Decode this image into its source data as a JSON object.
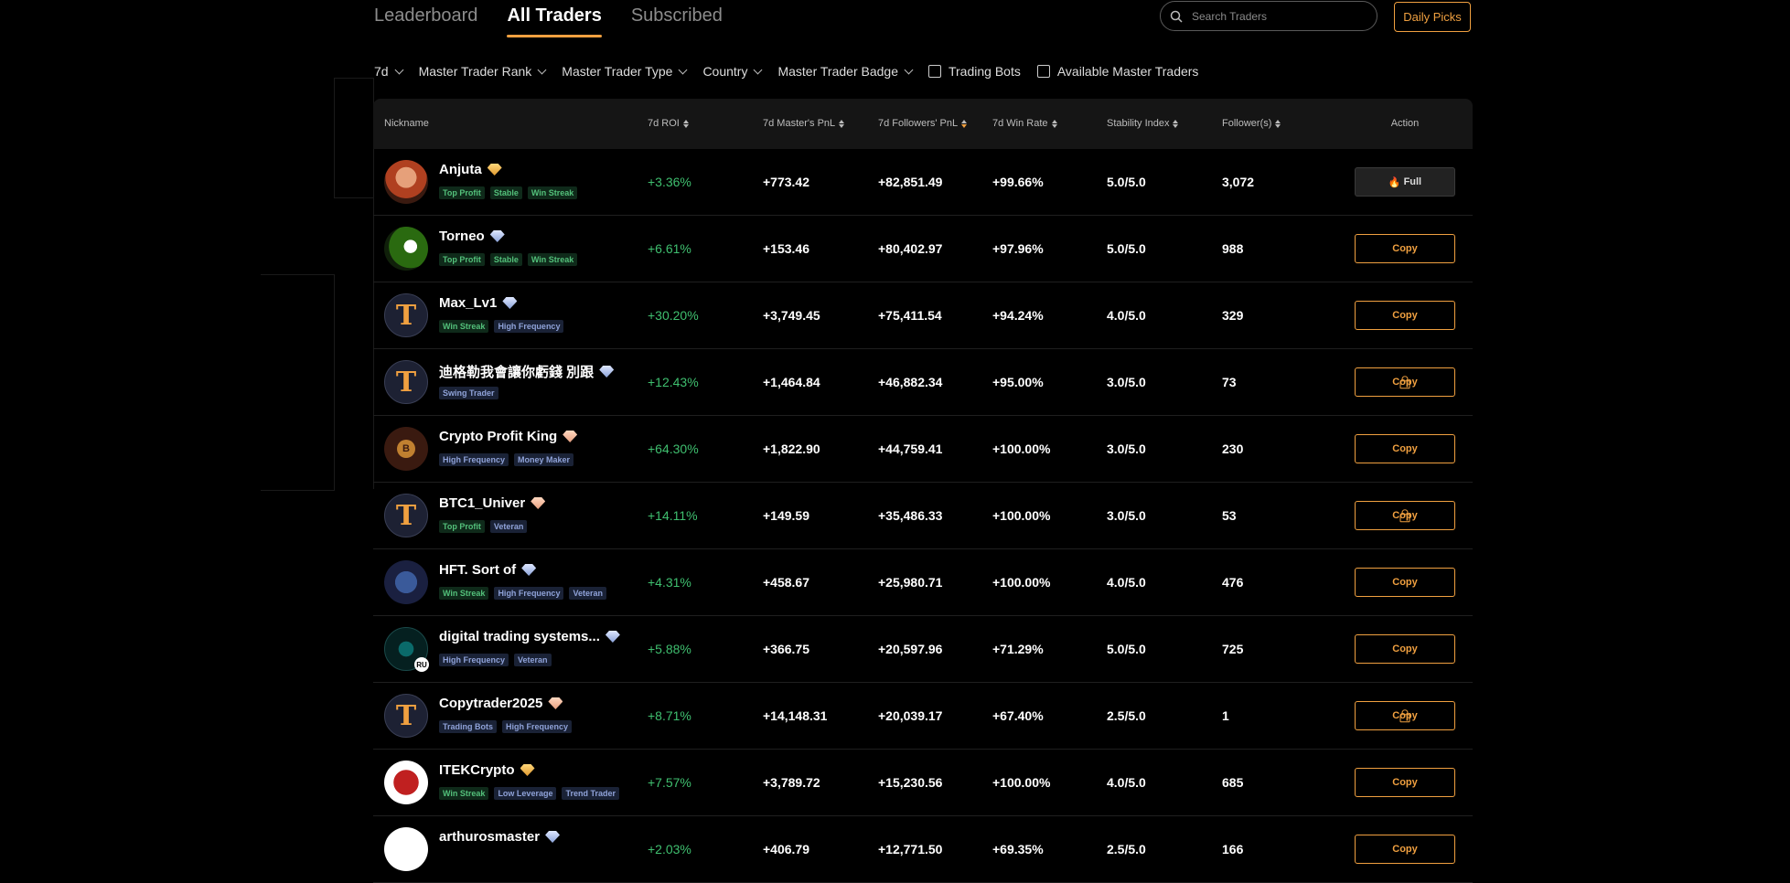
{
  "tabs": [
    {
      "label": "Leaderboard",
      "active": false
    },
    {
      "label": "All Traders",
      "active": true
    },
    {
      "label": "Subscribed",
      "active": false
    }
  ],
  "search": {
    "placeholder": "Search Traders",
    "icon": "search-icon"
  },
  "daily_picks": "Daily Picks",
  "filters": {
    "period": "7d",
    "rank": "Master Trader Rank",
    "type": "Master Trader Type",
    "country": "Country",
    "badge": "Master Trader Badge",
    "trading_bots": "Trading Bots",
    "available": "Available Master Traders"
  },
  "columns": {
    "nickname": "Nickname",
    "roi": "7d ROI",
    "master_pnl": "7d Master's PnL",
    "followers_pnl": "7d Followers' PnL",
    "win_rate": "7d Win Rate",
    "stability": "Stability Index",
    "followers": "Follower(s)",
    "action": "Action"
  },
  "colors": {
    "accent": "#f0a040",
    "positive": "#3fbf6f",
    "background": "#000000"
  },
  "traders": [
    {
      "name": "Anjuta",
      "gem": "gold",
      "avatar": "red-hair-photo",
      "tags": [
        {
          "label": "Top Profit",
          "c": "g"
        },
        {
          "label": "Stable",
          "c": "g"
        },
        {
          "label": "Win Streak",
          "c": "g"
        }
      ],
      "roi": "+3.36%",
      "master_pnl": "+773.42",
      "followers_pnl": "+82,851.49",
      "win_rate": "+99.66%",
      "stability": "5.0/5.0",
      "followers": "3,072",
      "action": "Full",
      "action_icon": "fire-icon",
      "locked": false
    },
    {
      "name": "Torneo",
      "gem": "blue",
      "avatar": "soccer-ball-photo",
      "tags": [
        {
          "label": "Top Profit",
          "c": "g"
        },
        {
          "label": "Stable",
          "c": "g"
        },
        {
          "label": "Win Streak",
          "c": "g"
        }
      ],
      "roi": "+6.61%",
      "master_pnl": "+153.46",
      "followers_pnl": "+80,402.97",
      "win_rate": "+97.96%",
      "stability": "5.0/5.0",
      "followers": "988",
      "action": "Copy",
      "locked": false
    },
    {
      "name": "Max_Lv1",
      "gem": "blue",
      "avatar": "t-logo",
      "tags": [
        {
          "label": "Win Streak",
          "c": "g"
        },
        {
          "label": "High Frequency",
          "c": "b"
        }
      ],
      "roi": "+30.20%",
      "master_pnl": "+3,749.45",
      "followers_pnl": "+75,411.54",
      "win_rate": "+94.24%",
      "stability": "4.0/5.0",
      "followers": "329",
      "action": "Copy",
      "locked": false
    },
    {
      "name": "迪格勒我會讓你虧錢 別跟",
      "gem": "blue",
      "avatar": "t-logo",
      "tags": [
        {
          "label": "Swing Trader",
          "c": "b"
        }
      ],
      "roi": "+12.43%",
      "master_pnl": "+1,464.84",
      "followers_pnl": "+46,882.34",
      "win_rate": "+95.00%",
      "stability": "3.0/5.0",
      "followers": "73",
      "action": "Copy",
      "locked": true
    },
    {
      "name": "Crypto Profit King",
      "gem": "peach",
      "avatar": "memecoin-logo",
      "tags": [
        {
          "label": "High Frequency",
          "c": "b"
        },
        {
          "label": "Money Maker",
          "c": "b"
        }
      ],
      "roi": "+64.30%",
      "master_pnl": "+1,822.90",
      "followers_pnl": "+44,759.41",
      "win_rate": "+100.00%",
      "stability": "3.0/5.0",
      "followers": "230",
      "action": "Copy",
      "locked": false
    },
    {
      "name": "BTC1_Univer",
      "gem": "peach",
      "avatar": "t-logo",
      "tags": [
        {
          "label": "Top Profit",
          "c": "g"
        },
        {
          "label": "Veteran",
          "c": "b"
        }
      ],
      "roi": "+14.11%",
      "master_pnl": "+149.59",
      "followers_pnl": "+35,486.33",
      "win_rate": "+100.00%",
      "stability": "3.0/5.0",
      "followers": "53",
      "action": "Copy",
      "locked": true
    },
    {
      "name": "HFT. Sort of",
      "gem": "blue",
      "avatar": "hft-logo",
      "tags": [
        {
          "label": "Win Streak",
          "c": "g"
        },
        {
          "label": "High Frequency",
          "c": "b"
        },
        {
          "label": "Veteran",
          "c": "b"
        }
      ],
      "roi": "+4.31%",
      "master_pnl": "+458.67",
      "followers_pnl": "+25,980.71",
      "win_rate": "+100.00%",
      "stability": "4.0/5.0",
      "followers": "476",
      "action": "Copy",
      "locked": false
    },
    {
      "name": "digital trading systems...",
      "gem": "blue",
      "avatar": "digital-logo",
      "country": "RU",
      "tags": [
        {
          "label": "High Frequency",
          "c": "b"
        },
        {
          "label": "Veteran",
          "c": "b"
        }
      ],
      "roi": "+5.88%",
      "master_pnl": "+366.75",
      "followers_pnl": "+20,597.96",
      "win_rate": "+71.29%",
      "stability": "5.0/5.0",
      "followers": "725",
      "action": "Copy",
      "locked": false
    },
    {
      "name": "Copytrader2025",
      "gem": "peach",
      "avatar": "t-logo",
      "tags": [
        {
          "label": "Trading Bots",
          "c": "b"
        },
        {
          "label": "High Frequency",
          "c": "b"
        }
      ],
      "roi": "+8.71%",
      "master_pnl": "+14,148.31",
      "followers_pnl": "+20,039.17",
      "win_rate": "+67.40%",
      "stability": "2.5/5.0",
      "followers": "1",
      "action": "Copy",
      "locked": true
    },
    {
      "name": "ITEKCrypto",
      "gem": "gold",
      "avatar": "bull-logo",
      "tags": [
        {
          "label": "Win Streak",
          "c": "g"
        },
        {
          "label": "Low Leverage",
          "c": "b"
        },
        {
          "label": "Trend Trader",
          "c": "b"
        }
      ],
      "roi": "+7.57%",
      "master_pnl": "+3,789.72",
      "followers_pnl": "+15,230.56",
      "win_rate": "+100.00%",
      "stability": "4.0/5.0",
      "followers": "685",
      "action": "Copy",
      "locked": false
    },
    {
      "name": "arthurosmaster",
      "gem": "blue",
      "avatar": "art-logo",
      "tags": [],
      "roi": "+2.03%",
      "master_pnl": "+406.79",
      "followers_pnl": "+12,771.50",
      "win_rate": "+69.35%",
      "stability": "2.5/5.0",
      "followers": "166",
      "action": "Copy",
      "locked": false
    }
  ]
}
